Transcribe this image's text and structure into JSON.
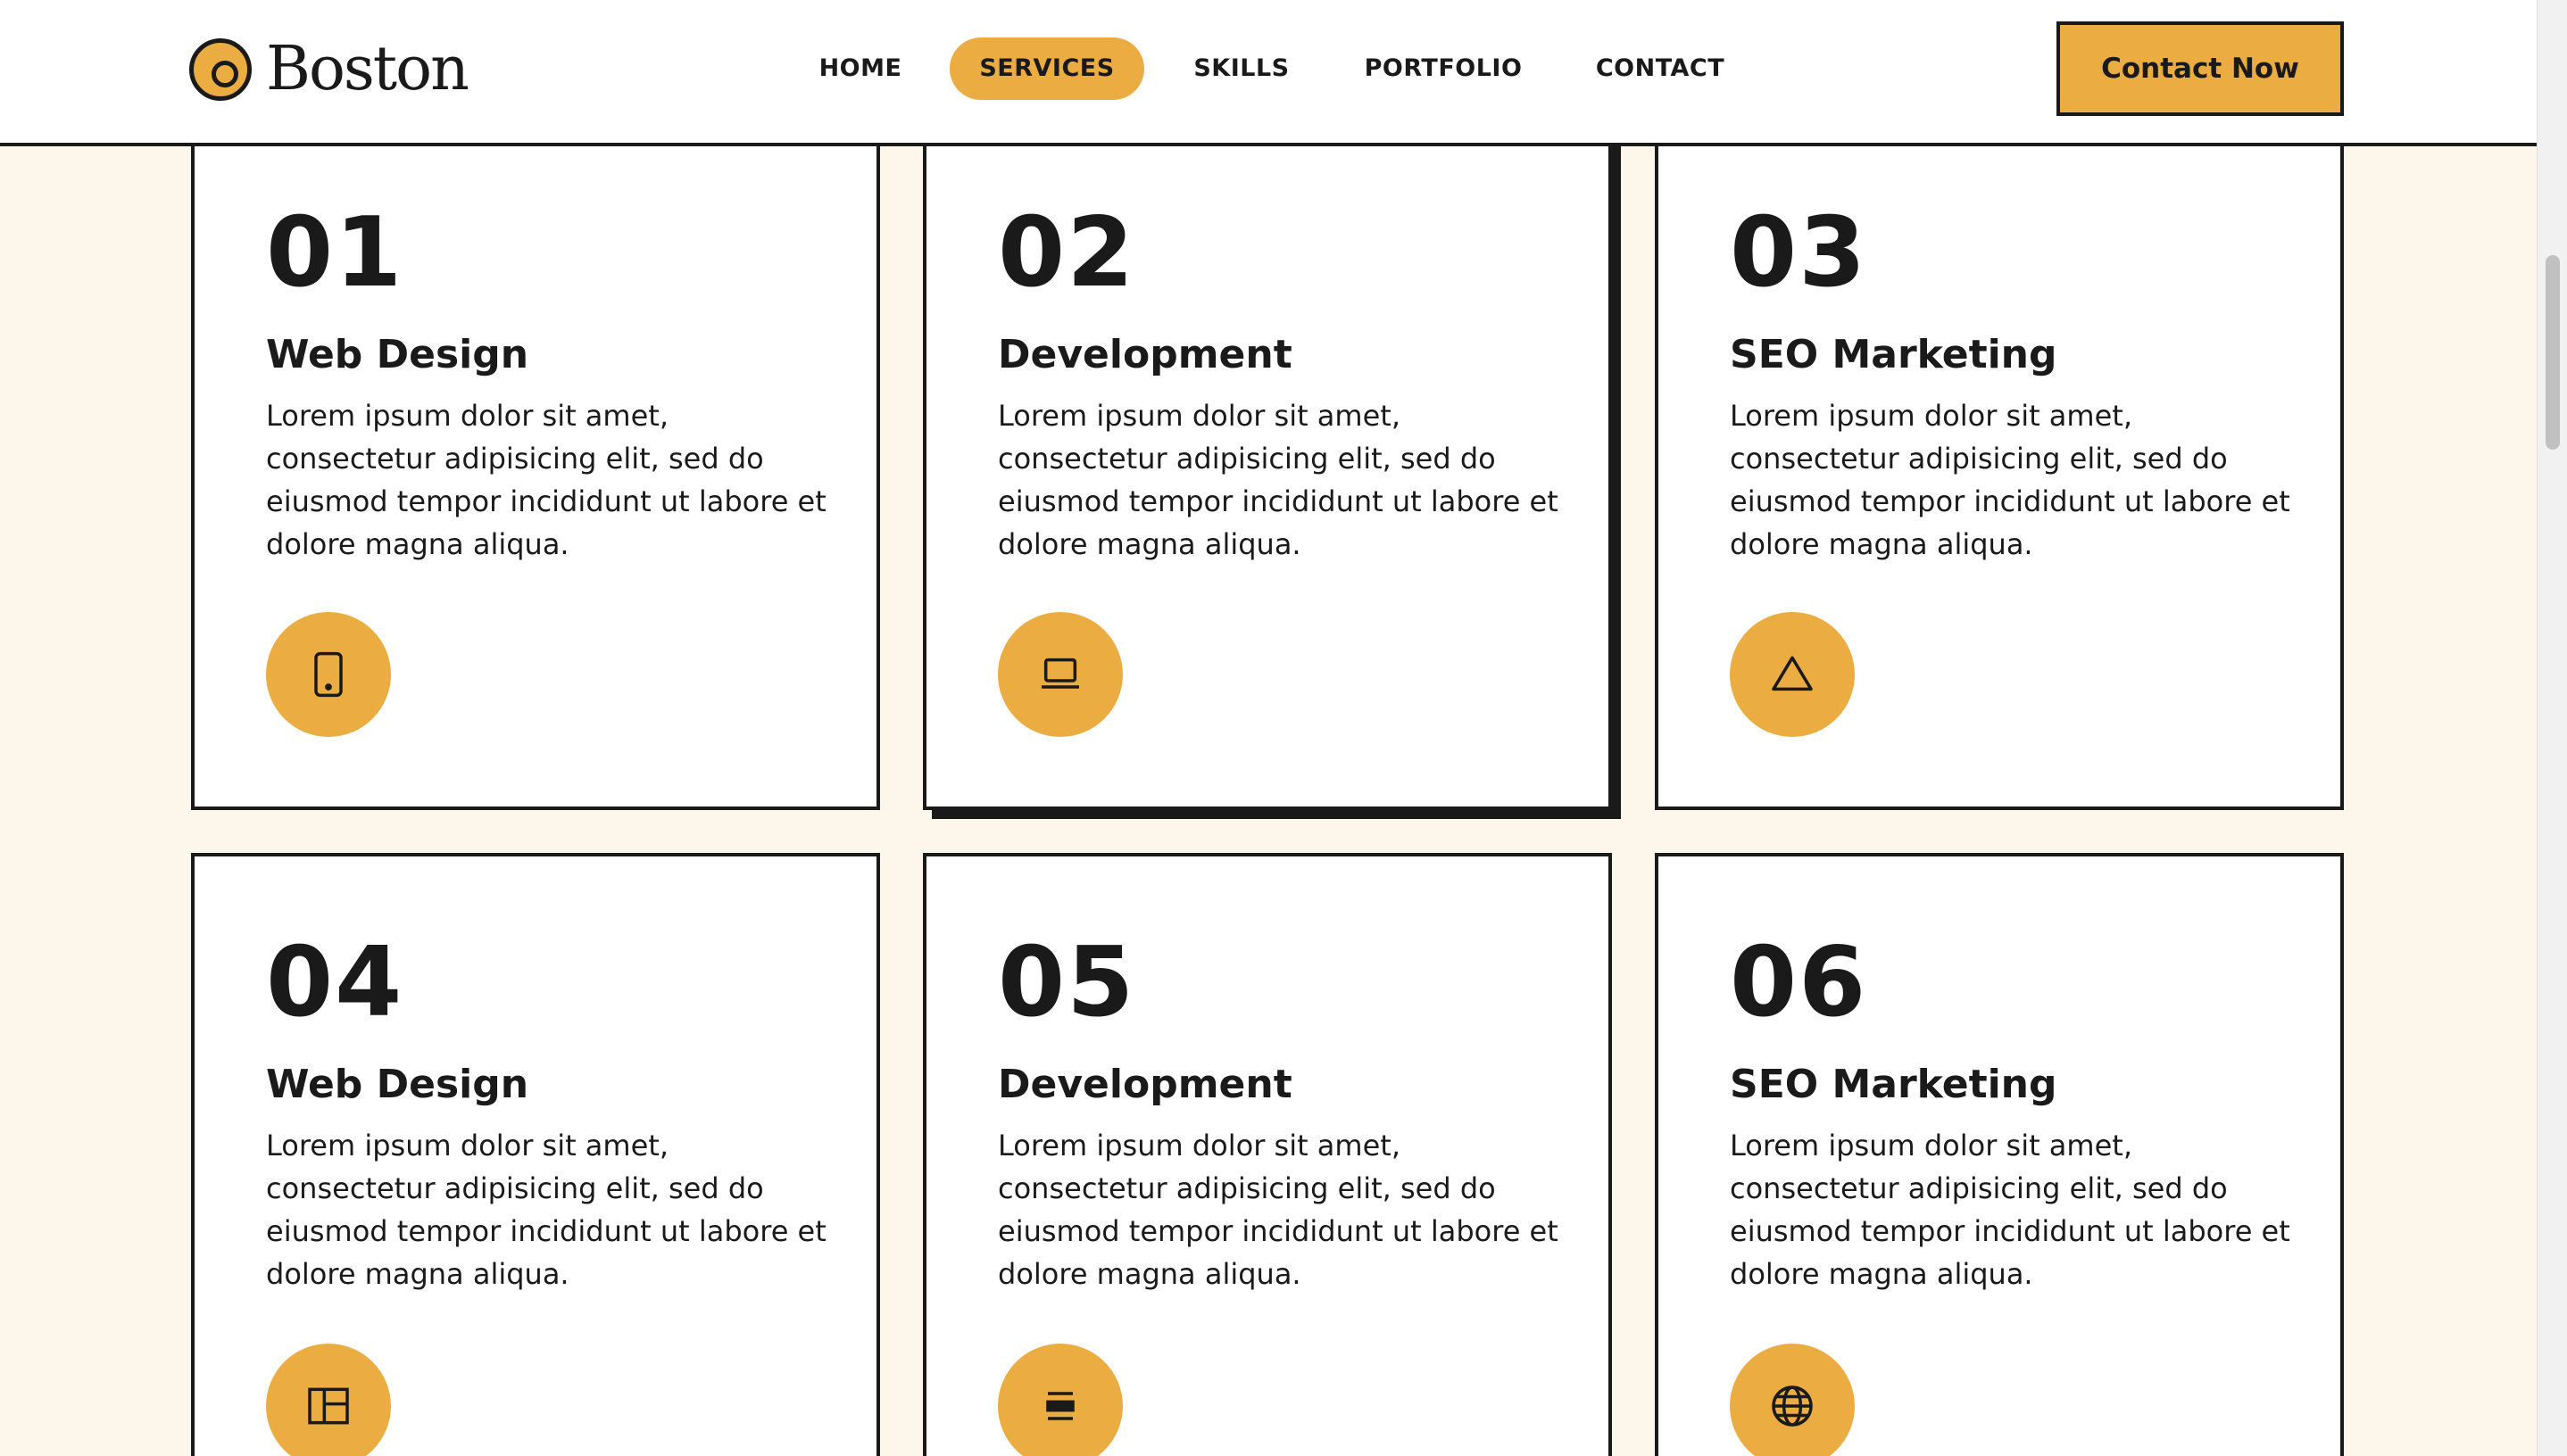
{
  "brand": {
    "name": "Boston"
  },
  "nav": {
    "items": [
      {
        "label": "HOME",
        "active": false
      },
      {
        "label": "SERVICES",
        "active": true
      },
      {
        "label": "SKILLS",
        "active": false
      },
      {
        "label": "PORTFOLIO",
        "active": false
      },
      {
        "label": "CONTACT",
        "active": false
      }
    ],
    "cta_label": "Contact Now"
  },
  "colors": {
    "accent": "#ebac42",
    "ink": "#1a1a1a",
    "page_bg": "#fdf6ea",
    "card_bg": "#ffffff"
  },
  "services": [
    {
      "number": "01",
      "title": "Web Design",
      "description": "Lorem ipsum dolor sit amet, consectetur adipisicing elit, sed do eiusmod tempor incididunt ut labore et dolore magna aliqua.",
      "icon": "tablet-icon"
    },
    {
      "number": "02",
      "title": "Development",
      "description": "Lorem ipsum dolor sit amet, consectetur adipisicing elit, sed do eiusmod tempor incididunt ut labore et dolore magna aliqua.",
      "icon": "laptop-icon"
    },
    {
      "number": "03",
      "title": "SEO Marketing",
      "description": "Lorem ipsum dolor sit amet, consectetur adipisicing elit, sed do eiusmod tempor incididunt ut labore et dolore magna aliqua.",
      "icon": "triangle-icon"
    },
    {
      "number": "04",
      "title": "Web Design",
      "description": "Lorem ipsum dolor sit amet, consectetur adipisicing elit, sed do eiusmod tempor incididunt ut labore et dolore magna aliqua.",
      "icon": "layout-icon"
    },
    {
      "number": "05",
      "title": "Development",
      "description": "Lorem ipsum dolor sit amet, consectetur adipisicing elit, sed do eiusmod tempor incididunt ut labore et dolore magna aliqua.",
      "icon": "menu-bars-icon"
    },
    {
      "number": "06",
      "title": "SEO Marketing",
      "description": "Lorem ipsum dolor sit amet, consectetur adipisicing elit, sed do eiusmod tempor incididunt ut labore et dolore magna aliqua.",
      "icon": "globe-icon"
    }
  ]
}
